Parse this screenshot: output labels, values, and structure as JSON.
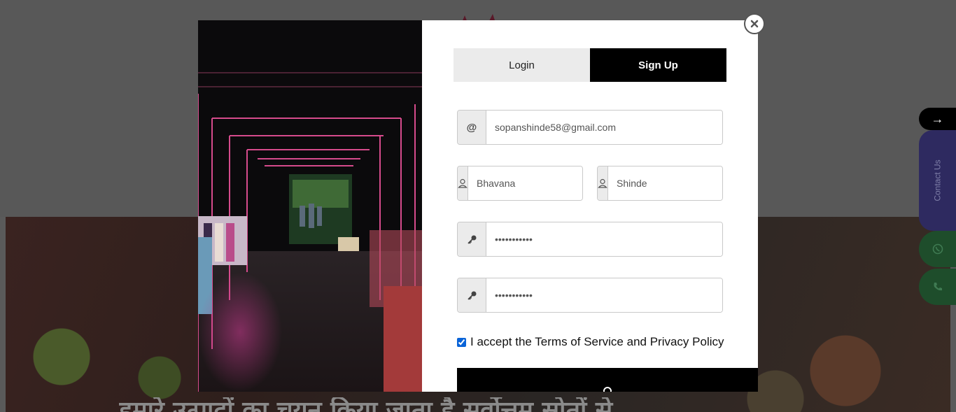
{
  "modal": {
    "tabs": [
      {
        "label": "Login",
        "active": false
      },
      {
        "label": "Sign Up",
        "active": true
      }
    ],
    "email": {
      "icon": "at-icon",
      "addon_text": "@",
      "value": "sopanshinde58@gmail.com"
    },
    "first_name": {
      "icon": "user-icon",
      "value": "Bhavana"
    },
    "last_name": {
      "icon": "user-icon",
      "value": "Shinde"
    },
    "password": {
      "icon": "key-icon",
      "value": "•••••••••••"
    },
    "confirm_password": {
      "icon": "key-icon",
      "value": "•••••••••••"
    },
    "terms": {
      "checked": true,
      "label": "I accept the Terms of Service and Privacy Policy"
    }
  },
  "side_widgets": {
    "arrow": "→",
    "contact_label": "Contact Us"
  },
  "background": {
    "hero_text": "हमारे उत्पादों का चयन किया जाता है सर्वोत्तम स्रोतों से"
  },
  "colors": {
    "accent": "#000000",
    "checkbox": "#0a64d8",
    "whatsapp_bg": "#1e4d2b",
    "contact_bg": "#2e2a60"
  }
}
